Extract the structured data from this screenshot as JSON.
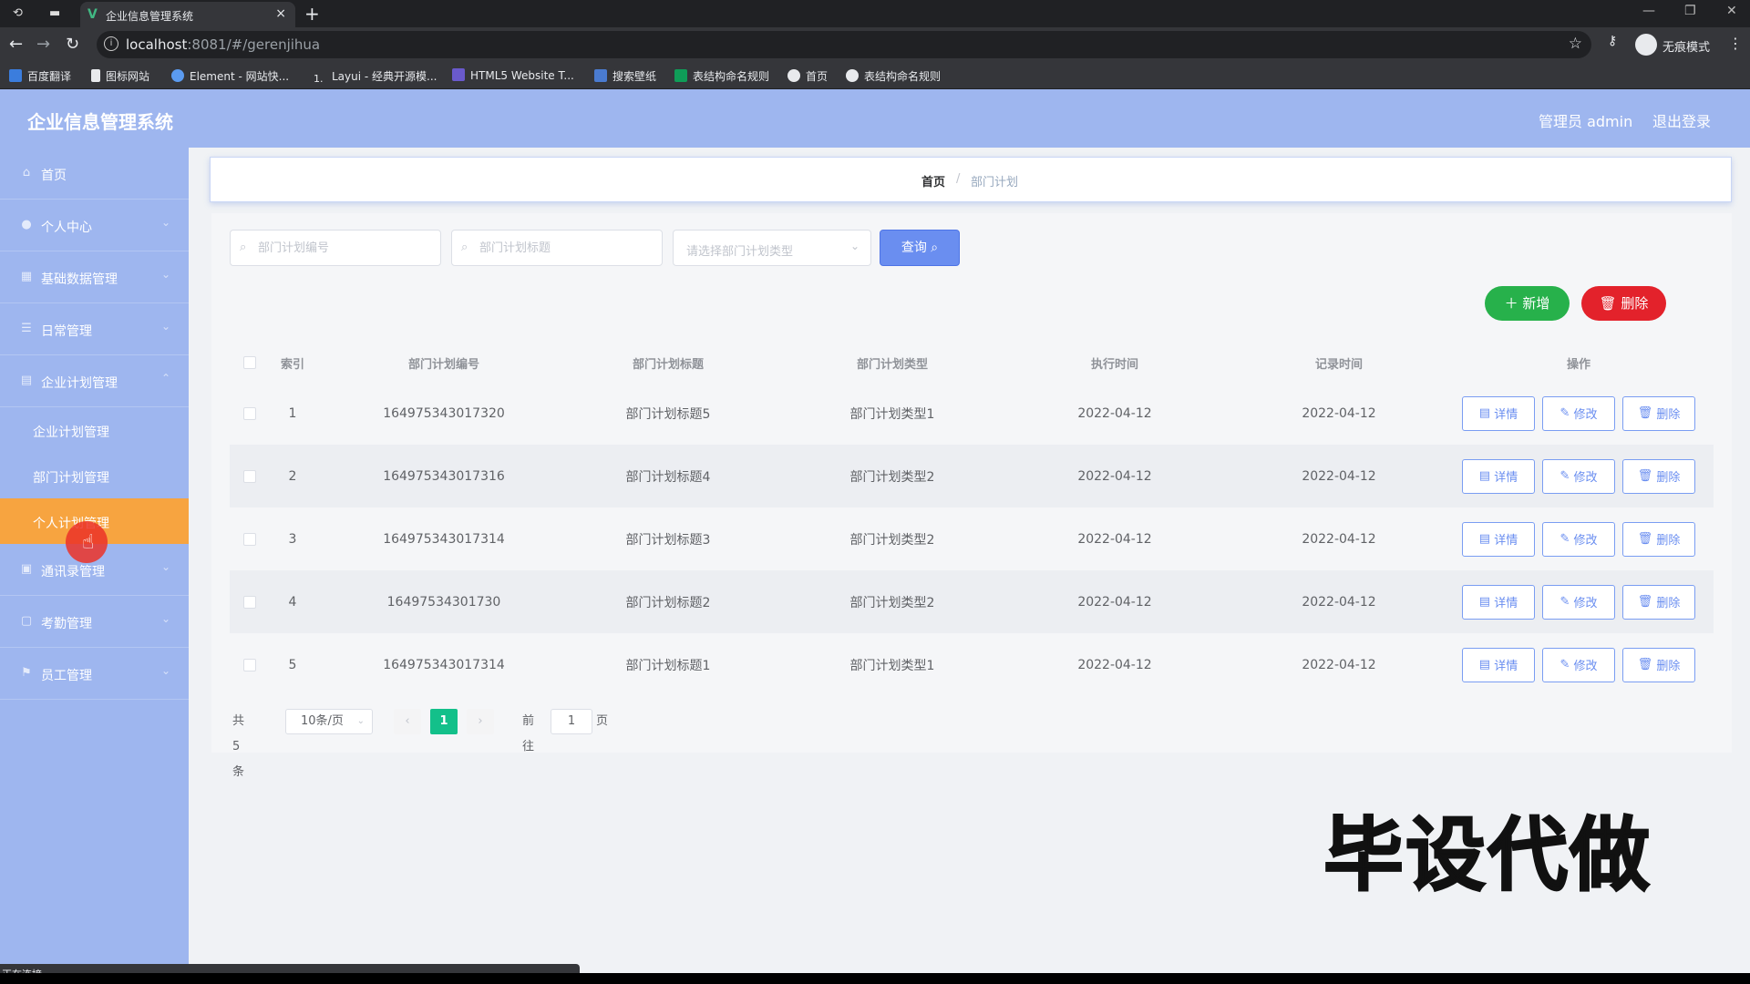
{
  "browser": {
    "tab_title": "企业信息管理系统",
    "url_host": "localhost",
    "url_rest": ":8081/#/gerenjihua",
    "incognito_label": "无痕模式",
    "bookmarks": [
      "百度翻译",
      "图标网站",
      "Element - 网站快...",
      "Layui - 经典开源模...",
      "HTML5 Website T...",
      "搜索壁纸",
      "表结构命名规则",
      "首页",
      "表结构命名规则"
    ]
  },
  "header": {
    "title": "企业信息管理系统",
    "admin_label": "管理员 admin",
    "logout_label": "退出登录"
  },
  "sidebar": {
    "items": [
      {
        "label": "首页",
        "icon": "home-icon"
      },
      {
        "label": "个人中心",
        "icon": "user-icon"
      },
      {
        "label": "基础数据管理",
        "icon": "database-icon"
      },
      {
        "label": "日常管理",
        "icon": "list-icon"
      },
      {
        "label": "企业计划管理",
        "icon": "plan-icon"
      }
    ],
    "subitems": [
      "企业计划管理",
      "部门计划管理",
      "个人计划管理"
    ],
    "items_after": [
      {
        "label": "通讯录管理",
        "icon": "contacts-icon"
      },
      {
        "label": "考勤管理",
        "icon": "attendance-icon"
      },
      {
        "label": "员工管理",
        "icon": "staff-icon"
      }
    ]
  },
  "breadcrumb": {
    "home": "首页",
    "separator": "/",
    "current": "部门计划"
  },
  "search": {
    "code_placeholder": "部门计划编号",
    "title_placeholder": "部门计划标题",
    "type_placeholder": "请选择部门计划类型",
    "query_label": "查询"
  },
  "actions": {
    "add_label": "新增",
    "delete_label": "删除"
  },
  "table": {
    "headers": [
      "索引",
      "部门计划编号",
      "部门计划标题",
      "部门计划类型",
      "执行时间",
      "记录时间",
      "操作"
    ],
    "rows": [
      {
        "index": "1",
        "code": "164975343017320",
        "title": "部门计划标题5",
        "type": "部门计划类型1",
        "exec_time": "2022-04-12",
        "record_time": "2022-04-12"
      },
      {
        "index": "2",
        "code": "164975343017316",
        "title": "部门计划标题4",
        "type": "部门计划类型2",
        "exec_time": "2022-04-12",
        "record_time": "2022-04-12"
      },
      {
        "index": "3",
        "code": "164975343017314",
        "title": "部门计划标题3",
        "type": "部门计划类型2",
        "exec_time": "2022-04-12",
        "record_time": "2022-04-12"
      },
      {
        "index": "4",
        "code": "16497534301730",
        "title": "部门计划标题2",
        "type": "部门计划类型2",
        "exec_time": "2022-04-12",
        "record_time": "2022-04-12"
      },
      {
        "index": "5",
        "code": "164975343017314",
        "title": "部门计划标题1",
        "type": "部门计划类型1",
        "exec_time": "2022-04-12",
        "record_time": "2022-04-12"
      }
    ],
    "row_actions": {
      "detail": "详情",
      "edit": "修改",
      "delete": "删除"
    }
  },
  "pagination": {
    "total_text": "共 5 条",
    "page_size": "10条/页",
    "current_page": "1",
    "goto_prefix": "前往",
    "goto_value": "1",
    "goto_suffix": "页"
  },
  "watermark": "毕设代做",
  "status_text": "正在连接...",
  "colors": {
    "header_bg": "#9eb6ef",
    "active_menu": "#f7a440",
    "primary": "#6a8ef0",
    "success": "#27b14b",
    "danger": "#e3222b",
    "page_active": "#13c08a"
  }
}
